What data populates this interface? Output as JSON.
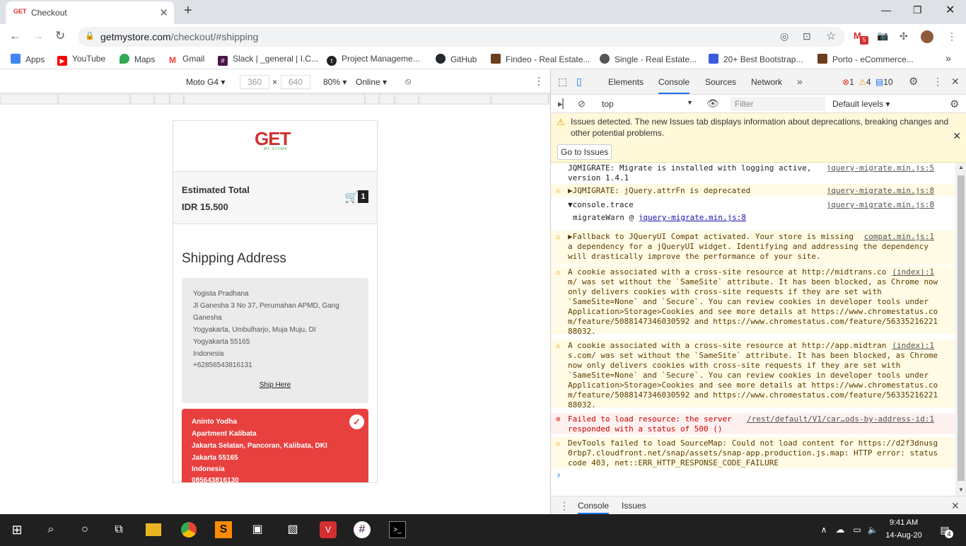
{
  "browser": {
    "tab_title": "Checkout",
    "tab_favicon": "GET",
    "url_host": "getmystore.com",
    "url_path": "/checkout/#shipping",
    "extension_badge": "5"
  },
  "bookmarks": [
    {
      "label": "Apps",
      "icon": "apps-icon",
      "color": "#4285f4"
    },
    {
      "label": "YouTube",
      "icon": "youtube-icon",
      "color": "#ff0000"
    },
    {
      "label": "Maps",
      "icon": "maps-icon",
      "color": "#34a853"
    },
    {
      "label": "Gmail",
      "icon": "gmail-icon",
      "color": "#ea4335"
    },
    {
      "label": "Slack | _general | I.C...",
      "icon": "slack-icon",
      "color": "#4a154b"
    },
    {
      "label": "Project Manageme...",
      "icon": "project-icon",
      "color": "#222222"
    },
    {
      "label": "GitHub",
      "icon": "github-icon",
      "color": "#24292e"
    },
    {
      "label": "Findeo - Real Estate...",
      "icon": "findeo-icon",
      "color": "#6b3e1e"
    },
    {
      "label": "Single - Real Estate...",
      "icon": "globe-icon",
      "color": "#555555"
    },
    {
      "label": "20+ Best Bootstrap...",
      "icon": "bootstrap-icon",
      "color": "#3b5bdb"
    },
    {
      "label": "Porto - eCommerce...",
      "icon": "porto-icon",
      "color": "#6b3e1e"
    }
  ],
  "device_toolbar": {
    "device": "Moto G4",
    "width": "360",
    "height": "640",
    "zoom": "80%",
    "network": "Online"
  },
  "page": {
    "logo_text": "GET",
    "logo_sub": "MY STORE",
    "estimated_total_label": "Estimated Total",
    "estimated_total_value": "IDR 15.500",
    "cart_count": "1",
    "shipping_heading": "Shipping Address",
    "address1": {
      "lines": [
        "Yogista Pradhana",
        "Jl Ganesha 3 No 37, Perumahan APMD, Gang",
        "Ganesha",
        "Yogyakarta, Umbulharjo, Muja Muju, DI",
        "Yogyakarta 55165",
        "Indonesia",
        "+62856543816131"
      ],
      "action": "Ship Here"
    },
    "address2": {
      "lines": [
        "Aninto Yodha",
        "Apartment Kalibata",
        "Jakarta Selatan, Pancoran, Kalibata, DKI",
        "Jakarta 55165",
        "Indonesia",
        "085643816130"
      ],
      "selected": true
    }
  },
  "devtools": {
    "tabs": [
      "Elements",
      "Console",
      "Sources",
      "Network"
    ],
    "active_tab": "Console",
    "errors": "1",
    "warnings": "4",
    "infos": "10",
    "context": "top",
    "filter_placeholder": "Filter",
    "levels": "Default levels",
    "issues_banner": "Issues detected. The new Issues tab displays information about deprecations, breaking changes and other potential problems.",
    "goto_issues": "Go to Issues",
    "drawer_tabs": [
      "Console",
      "Issues"
    ],
    "messages": [
      {
        "level": "info",
        "text": "JQMIGRATE: Migrate is installed with logging active,\nversion 1.4.1",
        "source": "jquery-migrate.min.js:5"
      },
      {
        "level": "warn",
        "text": "▶JQMIGRATE: jQuery.attrFn is deprecated",
        "source": "jquery-migrate.min.js:8"
      },
      {
        "level": "info",
        "text": "▼console.trace",
        "source": "jquery-migrate.min.js:8"
      },
      {
        "level": "info",
        "text": "migrateWarn @ ",
        "link": "jquery-migrate.min.js:8",
        "source": ""
      },
      {
        "level": "warn",
        "text": "▶Fallback to JQueryUI Compat activated. Your store is missing\na dependency for a jQueryUI widget. Identifying and addressing the dependency\nwill drastically improve the performance of your site.",
        "source": "compat.min.js:1"
      },
      {
        "level": "warn",
        "text": "A cookie associated with a cross-site resource at http://midtrans.co\nm/ was set without the `SameSite` attribute. It has been blocked, as Chrome now\nonly delivers cookies with cross-site requests if they are set with\n`SameSite=None` and `Secure`. You can review cookies in developer tools under\nApplication>Storage>Cookies and see more details at https://www.chromestatus.co\nm/feature/5088147346030592 and https://www.chromestatus.com/feature/56335216221\n88032.",
        "source": "(index):1"
      },
      {
        "level": "warn",
        "text": "A cookie associated with a cross-site resource at http://app.midtran\ns.com/ was set without the `SameSite` attribute. It has been blocked, as Chrome\nnow only delivers cookies with cross-site requests if they are set with\n`SameSite=None` and `Secure`. You can review cookies in developer tools under\nApplication>Storage>Cookies and see more details at https://www.chromestatus.co\nm/feature/5088147346030592 and https://www.chromestatus.com/feature/56335216221\n88032.",
        "source": "(index):1"
      },
      {
        "level": "error",
        "text": "Failed to load resource: the server\nresponded with a status of 500 ()",
        "source": "/rest/default/V1/car…ods-by-address-id:1"
      },
      {
        "level": "warn",
        "text": "DevTools failed to load SourceMap: Could not load content for https://d2f3dnusg\n0rbp7.cloudfront.net/snap/assets/snap-app.production.js.map: HTTP error: status\ncode 403, net::ERR_HTTP_RESPONSE_CODE_FAILURE",
        "source": ""
      }
    ]
  },
  "taskbar": {
    "time": "9:41 AM",
    "date": "14-Aug-20",
    "notification_count": "4"
  }
}
